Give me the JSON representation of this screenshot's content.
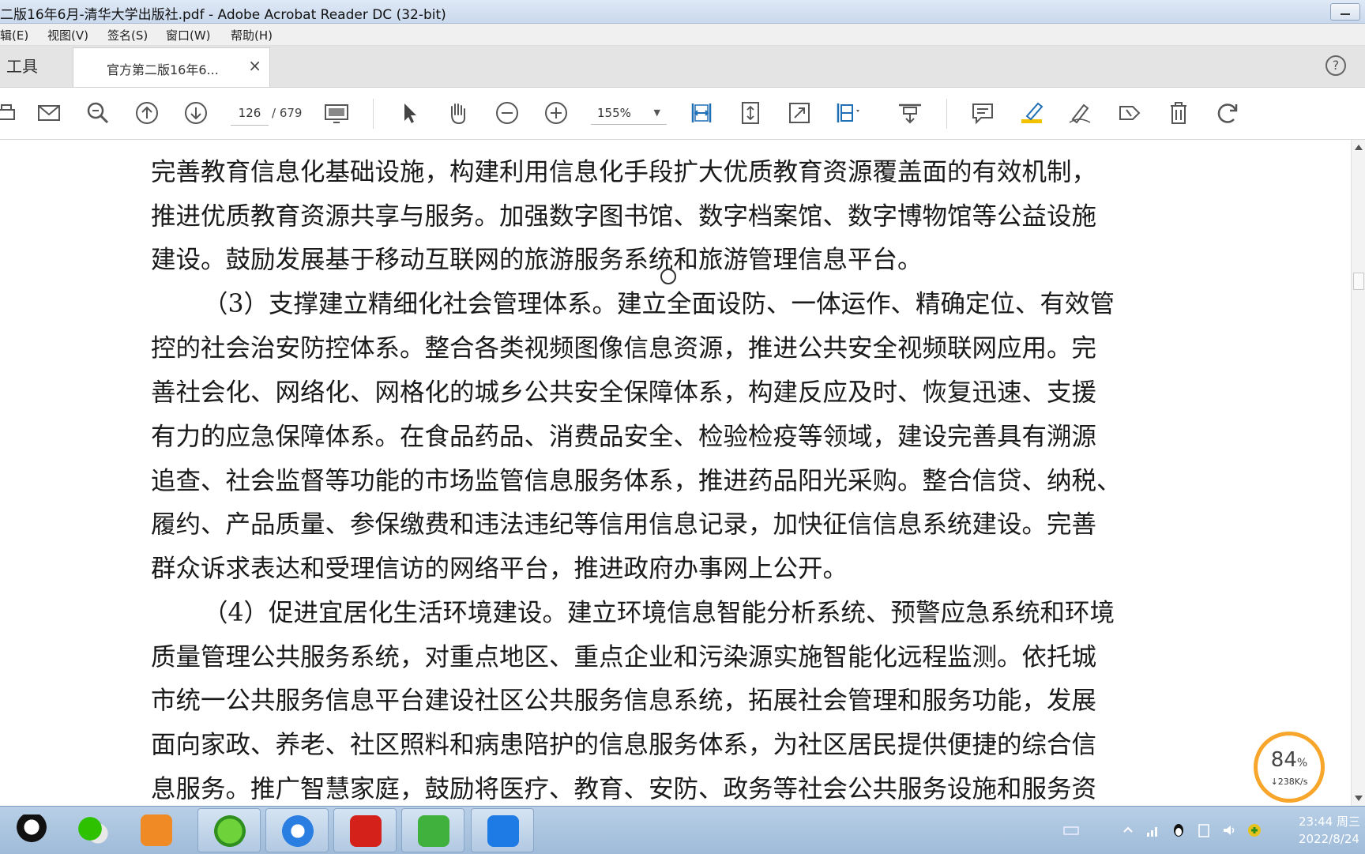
{
  "window": {
    "title": "二版16年6月-清华大学出版社.pdf - Adobe Acrobat Reader DC (32-bit)"
  },
  "menu": {
    "items": [
      "辑(E)",
      "视图(V)",
      "签名(S)",
      "窗口(W)",
      "帮助(H)"
    ]
  },
  "tabs": {
    "tools": "工具",
    "document": "官方第二版16年6...",
    "close": "×",
    "help": "?"
  },
  "toolbar": {
    "page_current": "126",
    "page_total": "/ 679",
    "zoom": "155%"
  },
  "document": {
    "lines": [
      "完善教育信息化基础设施，构建利用信息化手段扩大优质教育资源覆盖面的有效机制，",
      "推进优质教育资源共享与服务。加强数字图书馆、数字档案馆、数字博物馆等公益设施",
      "建设。鼓励发展基于移动互联网的旅游服务系统和旅游管理信息平台。",
      "（3）支撑建立精细化社会管理体系。建立全面设防、一体运作、精确定位、有效管",
      "控的社会治安防控体系。整合各类视频图像信息资源，推进公共安全视频联网应用。完",
      "善社会化、网络化、网格化的城乡公共安全保障体系，构建反应及时、恢复迅速、支援",
      "有力的应急保障体系。在食品药品、消费品安全、检验检疫等领域，建设完善具有溯源",
      "追查、社会监督等功能的市场监管信息服务体系，推进药品阳光采购。整合信贷、纳税、",
      "履约、产品质量、参保缴费和违法违纪等信用信息记录，加快征信信息系统建设。完善",
      "群众诉求表达和受理信访的网络平台，推进政府办事网上公开。",
      "（4）促进宜居化生活环境建设。建立环境信息智能分析系统、预警应急系统和环境",
      "质量管理公共服务系统，对重点地区、重点企业和污染源实施智能化远程监测。依托城",
      "市统一公共服务信息平台建设社区公共服务信息系统，拓展社会管理和服务功能，发展",
      "面向家政、养老、社区照料和病患陪护的信息服务体系，为社区居民提供便捷的综合信",
      "息服务。推广智慧家庭，鼓励将医疗、教育、安防、政务等社会公共服务设施和服务资"
    ]
  },
  "widget": {
    "percent": "84",
    "percent_unit": "%",
    "speed": "↓238K/s"
  },
  "tray": {
    "time": "23:44 周三",
    "date": "2022/8/24"
  },
  "colors": {
    "accent": "#1f6fb5",
    "widget_ring": "#f7a62b",
    "highlighter": "#f2c200"
  }
}
